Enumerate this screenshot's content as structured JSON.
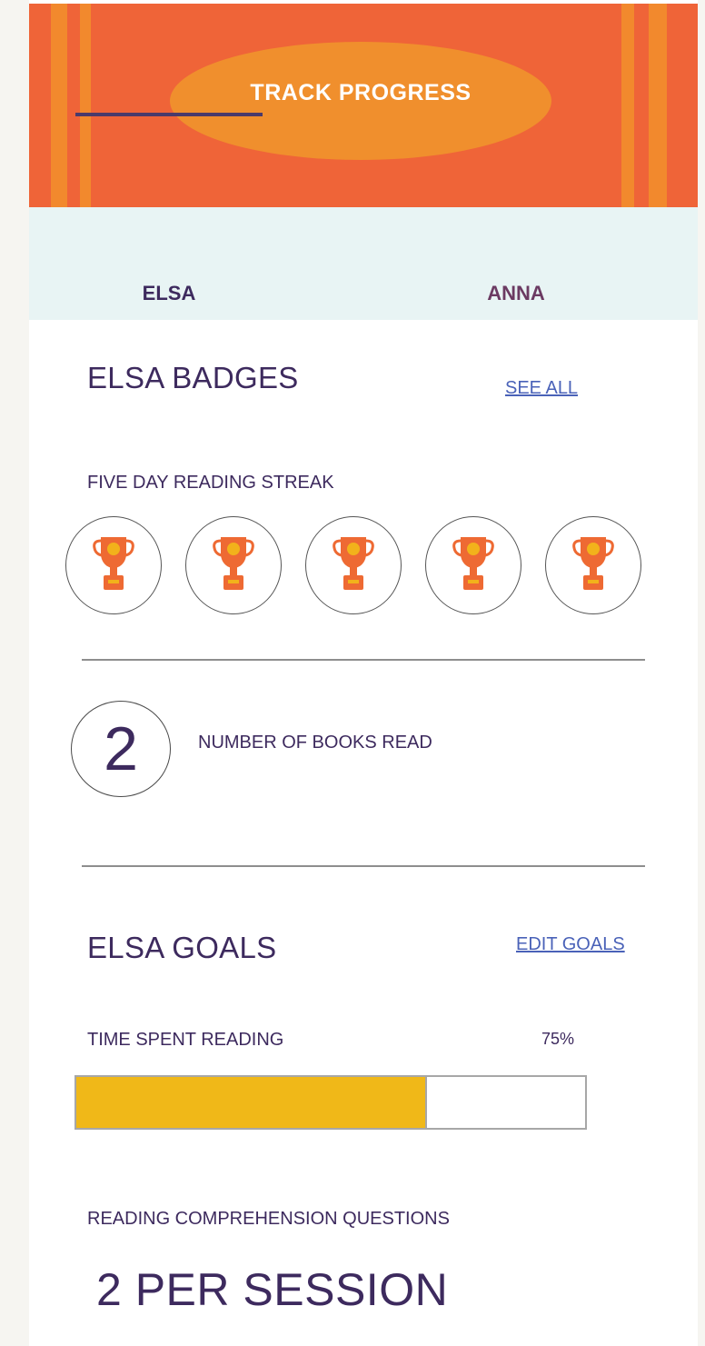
{
  "header": {
    "title": "TRACK PROGRESS"
  },
  "tabs": [
    {
      "label": "ELSA",
      "active": true
    },
    {
      "label": "ANNA",
      "active": false
    }
  ],
  "badges": {
    "title": "ELSA BADGES",
    "see_all": "SEE ALL",
    "streak_label": "FIVE DAY READING STREAK",
    "trophy_count": 5,
    "icon": "trophy-icon"
  },
  "books": {
    "count": "2",
    "label": "NUMBER OF BOOKS READ"
  },
  "goals": {
    "title": "ELSA GOALS",
    "edit": "EDIT GOALS",
    "time_label": "TIME SPENT READING",
    "time_percent_text": "75%",
    "time_progress": 0.69,
    "comprehension_label": "READING COMPREHENSION QUESTIONS",
    "comprehension_value": "2 PER SESSION"
  },
  "colors": {
    "banner": "#ef6438",
    "banner_accent": "#f2892d",
    "tab_background": "#e8f4f4",
    "text": "#3d2a5e",
    "link": "#4a62b8",
    "progress": "#f0b818",
    "trophy": "#ee6a33"
  }
}
